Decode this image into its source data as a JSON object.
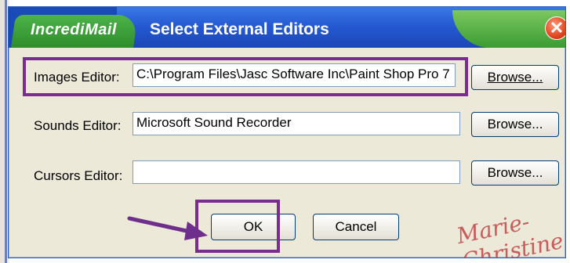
{
  "window": {
    "brand": "IncrediMail",
    "title": "Select External Editors",
    "close_glyph": "✕"
  },
  "rows": [
    {
      "label": "Images Editor:",
      "value": "C:\\Program Files\\Jasc Software Inc\\Paint Shop Pro 7",
      "button": "Browse..."
    },
    {
      "label": "Sounds Editor:",
      "value": "Microsoft Sound Recorder",
      "button": "Browse..."
    },
    {
      "label": "Cursors Editor:",
      "value": "",
      "button": "Browse..."
    }
  ],
  "footer": {
    "ok_label": "OK",
    "cancel_label": "Cancel"
  },
  "annotation": {
    "signature": "Marie-Christine",
    "highlight_color": "#7b2c8f"
  },
  "colors": {
    "title_blue": "#2457d0",
    "brand_green": "#3b9b34",
    "dialog_bg": "#ece9d8"
  }
}
